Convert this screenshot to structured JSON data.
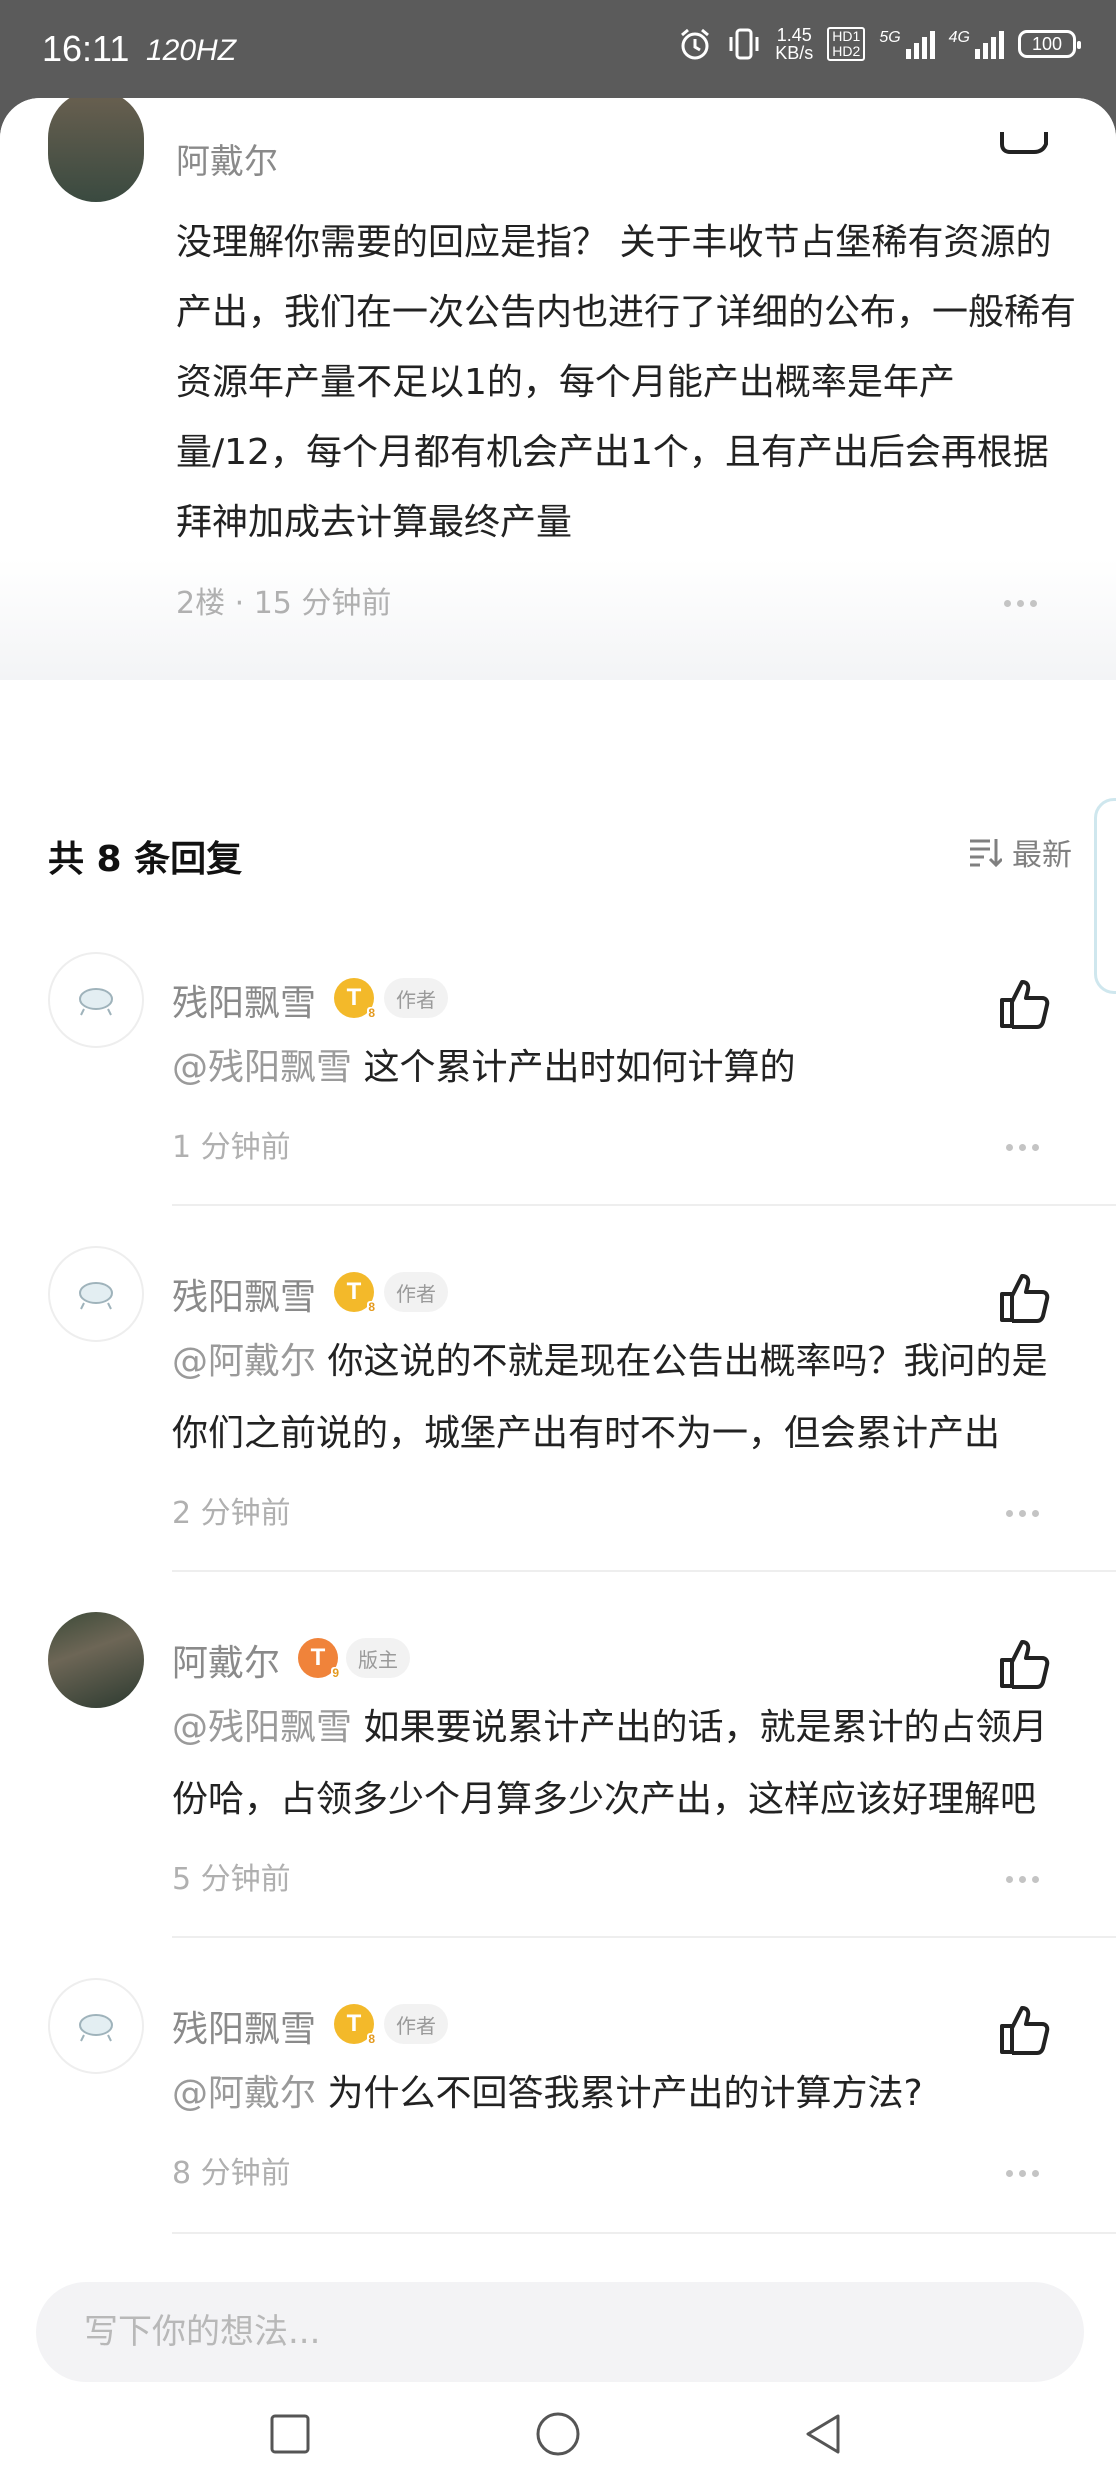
{
  "status_bar": {
    "time": "16:11",
    "refresh": "120HZ",
    "net_speed_value": "1.45",
    "net_speed_unit": "KB/s",
    "hd1": "HD1",
    "hd2": "HD2",
    "sig1_tag": "5G",
    "sig2_tag": "4G",
    "battery": "100"
  },
  "main_comment": {
    "author": "阿戴尔",
    "text": "没理解你需要的回应是指？ 关于丰收节占堡稀有资源的产出，我们在一次公告内也进行了详细的公布，一般稀有资源年产量不足以1的，每个月能产出概率是年产量/12，每个月都有机会产出1个，且有产出后会再根据拜神加成去计算最终产量",
    "meta": "2楼 · 15 分钟前"
  },
  "replies_header": {
    "title": "共 8 条回复",
    "sort_label": "最新"
  },
  "replies": [
    {
      "author": "残阳飘雪",
      "level": "T",
      "level_sub": "8",
      "role": "作者",
      "mention": "@残阳飘雪",
      "text": "这个累计产出时如何计算的",
      "time": "1 分钟前"
    },
    {
      "author": "残阳飘雪",
      "level": "T",
      "level_sub": "8",
      "role": "作者",
      "mention": "@阿戴尔",
      "text": "你这说的不就是现在公告出概率吗？我问的是你们之前说的，城堡产出有时不为一，但会累计产出",
      "time": "2 分钟前"
    },
    {
      "author": "阿戴尔",
      "level": "T",
      "level_sub": "9",
      "role": "版主",
      "mention": "@残阳飘雪",
      "text": "如果要说累计产出的话，就是累计的占领月份哈，占领多少个月算多少次产出，这样应该好理解吧",
      "time": "5 分钟前"
    },
    {
      "author": "残阳飘雪",
      "level": "T",
      "level_sub": "8",
      "role": "作者",
      "mention": "@阿戴尔",
      "text": "为什么不回答我累计产出的计算方法?",
      "time": "8 分钟前"
    }
  ],
  "input": {
    "placeholder": "写下你的想法..."
  },
  "icons": {
    "like": "thumbs-up-icon",
    "more": "more-dots-icon",
    "sort": "sort-icon",
    "nav": [
      "recent-apps-icon",
      "home-icon",
      "back-icon"
    ]
  }
}
